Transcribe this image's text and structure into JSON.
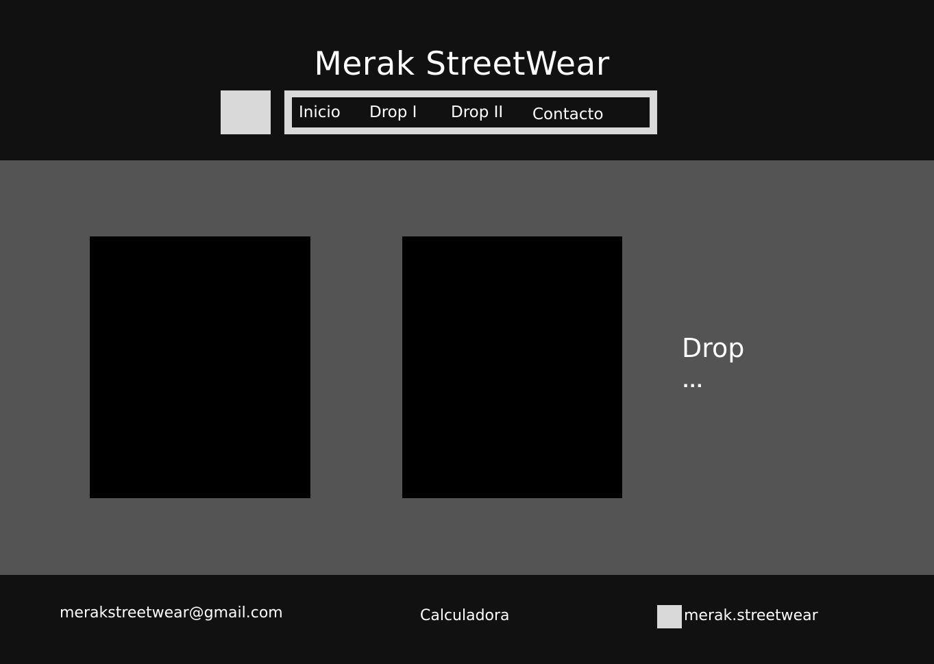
{
  "header": {
    "title": "Merak StreetWear",
    "nav": {
      "inicio": "Inicio",
      "drop1": "Drop I",
      "drop2": "Drop II",
      "contacto": "Contacto"
    }
  },
  "main": {
    "drop_title": "Drop",
    "drop_more": "..."
  },
  "footer": {
    "email": "merakstreetwear@gmail.com",
    "calculator": "Calculadora",
    "instagram": "merak.streetwear"
  },
  "colors": {
    "header_bg": "#111111",
    "main_bg": "#545454",
    "placeholder": "#d9d9d9",
    "image_placeholder": "#000000",
    "text": "#ffffff"
  }
}
